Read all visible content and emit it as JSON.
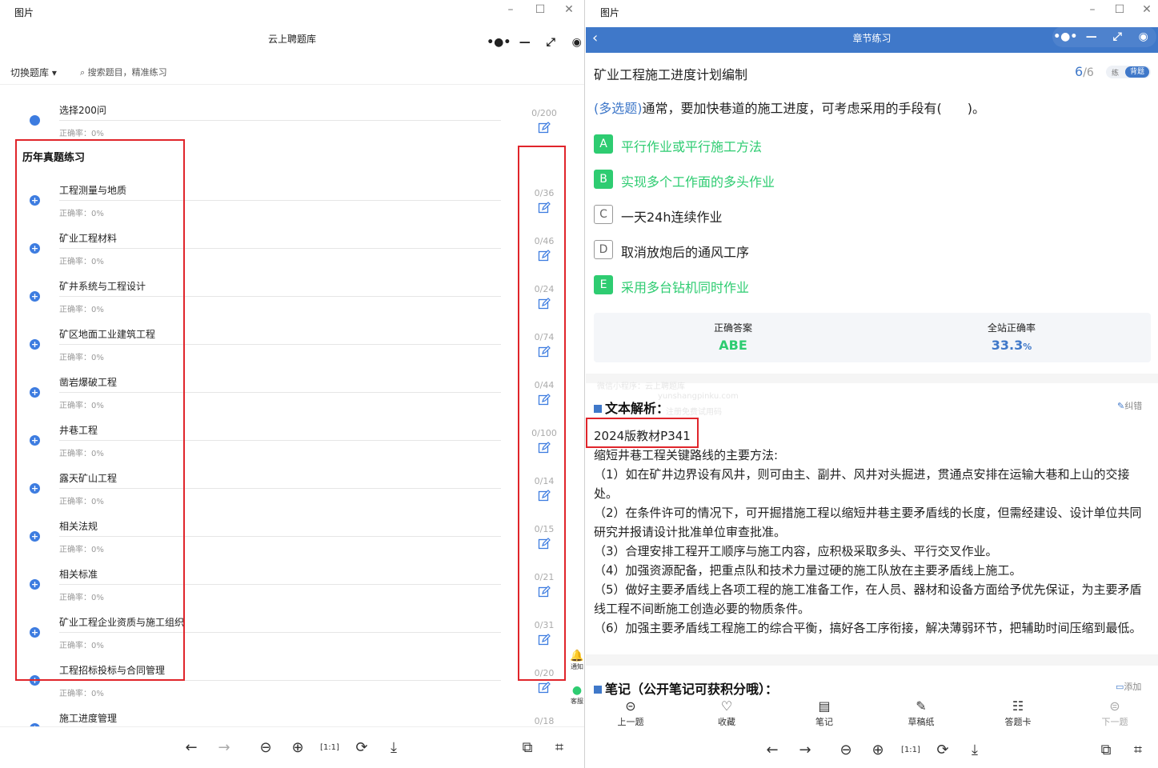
{
  "left_window": {
    "title": "图片",
    "app_title": "云上聘题库",
    "switch_bank": "切换题库",
    "search_placeholder": "搜索题目，精准练习",
    "first_item": {
      "name": "选择200问",
      "accuracy": "正确率：0%",
      "count": "0/200"
    },
    "section_title": "历年真题练习",
    "items": [
      {
        "name": "工程测量与地质",
        "accuracy": "正确率：0%",
        "count": "0/36"
      },
      {
        "name": "矿业工程材料",
        "accuracy": "正确率：0%",
        "count": "0/46"
      },
      {
        "name": "矿井系统与工程设计",
        "accuracy": "正确率：0%",
        "count": "0/24"
      },
      {
        "name": "矿区地面工业建筑工程",
        "accuracy": "正确率：0%",
        "count": "0/74"
      },
      {
        "name": "凿岩爆破工程",
        "accuracy": "正确率：0%",
        "count": "0/44"
      },
      {
        "name": "井巷工程",
        "accuracy": "正确率：0%",
        "count": "0/100"
      },
      {
        "name": "露天矿山工程",
        "accuracy": "正确率：0%",
        "count": "0/14"
      },
      {
        "name": "相关法规",
        "accuracy": "正确率：0%",
        "count": "0/15"
      },
      {
        "name": "相关标准",
        "accuracy": "正确率：0%",
        "count": "0/21"
      },
      {
        "name": "矿业工程企业资质与施工组织",
        "accuracy": "正确率：0%",
        "count": "0/31"
      },
      {
        "name": "工程招标投标与合同管理",
        "accuracy": "正确率：0%",
        "count": "0/20"
      },
      {
        "name": "施工进度管理",
        "accuracy": "",
        "count": "0/18"
      }
    ],
    "side_buttons": {
      "notify": "通知",
      "service": "客服"
    }
  },
  "right_window": {
    "title": "图片",
    "app_title": "章节练习",
    "chapter_title": "矿业工程施工进度计划编制",
    "progress_current": "6",
    "progress_total": "/6",
    "mode_practice": "练",
    "mode_recite": "背题",
    "question_type": "(多选题)",
    "question_text": "通常，要加快巷道的施工进度，可考虑采用的手段有(　　)。",
    "options": [
      {
        "letter": "A",
        "text": "平行作业或平行施工方法",
        "correct": true
      },
      {
        "letter": "B",
        "text": "实现多个工作面的多头作业",
        "correct": true
      },
      {
        "letter": "C",
        "text": "一天24h连续作业",
        "correct": false
      },
      {
        "letter": "D",
        "text": "取消放炮后的通风工序",
        "correct": false
      },
      {
        "letter": "E",
        "text": "采用多台钻机同时作业",
        "correct": true
      }
    ],
    "correct_answer_label": "正确答案",
    "correct_answer": "ABE",
    "site_rate_label": "全站正确率",
    "site_rate": "33.3",
    "site_rate_unit": "%",
    "watermark": [
      "微信小程序：云上聘题库",
      "yunshangpinku.com",
      "注册免费试用码"
    ],
    "analysis_title": "文本解析：",
    "report_error": "纠错",
    "analysis_source": "2024版教材P341",
    "analysis_lines": [
      "缩短井巷工程关键路线的主要方法:",
      "（1）如在矿井边界设有风井，则可由主、副井、风井对头掘进，贯通点安排在运输大巷和上山的交接处。",
      "（2）在条件许可的情况下，可开掘措施工程以缩短井巷主要矛盾线的长度，但需经建设、设计单位共同研究并报请设计批准单位审查批准。",
      "（3）合理安排工程开工顺序与施工内容，应积极采取多头、平行交叉作业。",
      "（4）加强资源配备，把重点队和技术力量过硬的施工队放在主要矛盾线上施工。",
      "（5）做好主要矛盾线上各项工程的施工准备工作，在人员、器材和设备方面给予优先保证，为主要矛盾线工程不间断施工创造必要的物质条件。",
      "（6）加强主要矛盾线工程施工的综合平衡，搞好各工序衔接，解决薄弱环节，把辅助时间压缩到最低。"
    ],
    "notes_title": "笔记（公开笔记可获积分哦）：",
    "add_note": "添加",
    "tools": [
      {
        "icon": "prev-circle-icon",
        "label": "上一题"
      },
      {
        "icon": "heart-icon",
        "label": "收藏"
      },
      {
        "icon": "notebook-icon",
        "label": "笔记"
      },
      {
        "icon": "draft-icon",
        "label": "草稿纸"
      },
      {
        "icon": "answer-card-icon",
        "label": "答题卡"
      },
      {
        "icon": "next-circle-icon",
        "label": "下一题"
      }
    ]
  },
  "colors": {
    "accent": "#3f78c9",
    "correct": "#2ecc71",
    "highlight_box": "#e0252b"
  }
}
